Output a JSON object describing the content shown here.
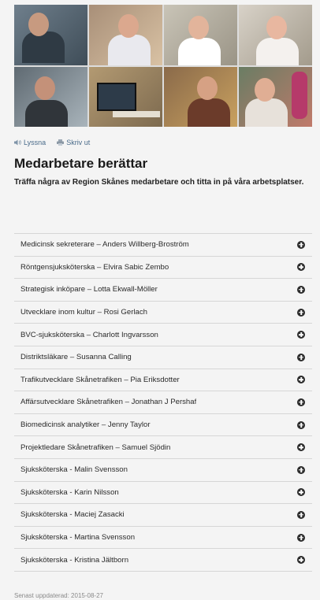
{
  "tools": {
    "listen_label": "Lyssna",
    "print_label": "Skriv ut"
  },
  "page": {
    "title": "Medarbetare berättar",
    "intro": "Träffa några av Region Skånes medarbetare och titta in på våra arbetsplatser."
  },
  "employees": [
    {
      "label": "Medicinsk sekreterare – Anders Willberg-Broström"
    },
    {
      "label": "Röntgensjuksköterska – Elvira Sabic Zembo"
    },
    {
      "label": "Strategisk inköpare – Lotta Ekwall-Möller"
    },
    {
      "label": "Utvecklare inom kultur – Rosi Gerlach"
    },
    {
      "label": "BVC-sjuksköterska – Charlott Ingvarsson"
    },
    {
      "label": "Distriktsläkare – Susanna Calling"
    },
    {
      "label": "Trafikutvecklare Skånetrafiken – Pia Eriksdotter"
    },
    {
      "label": "Affärsutvecklare Skånetrafiken – Jonathan J Pershaf"
    },
    {
      "label": "Biomedicinsk analytiker – Jenny Taylor"
    },
    {
      "label": "Projektledare Skånetrafiken – Samuel Sjödin"
    },
    {
      "label": "Sjuksköterska - Malin Svensson"
    },
    {
      "label": "Sjuksköterska - Karin Nilsson"
    },
    {
      "label": "Sjuksköterska - Maciej Zasacki"
    },
    {
      "label": "Sjuksköterska - Martina Svensson"
    },
    {
      "label": "Sjuksköterska - Kristina Jältborn"
    }
  ],
  "footer": {
    "updated": "Senast uppdaterad: 2015-08-27"
  },
  "colors": {
    "link": "#4a6b8a",
    "expand_icon": "#2b2b2b"
  }
}
